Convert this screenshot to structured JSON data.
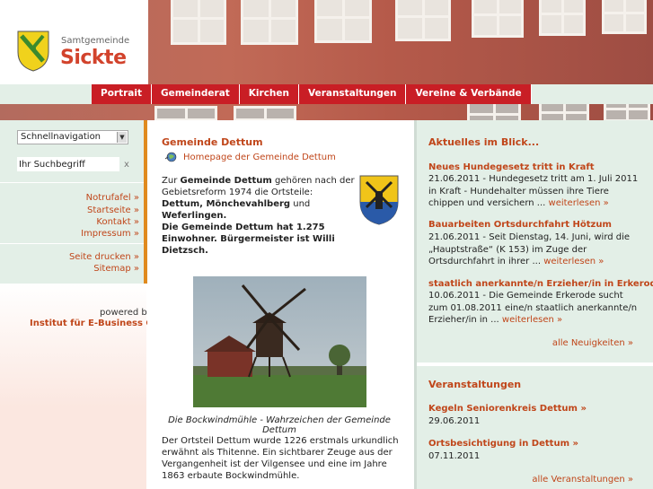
{
  "logo": {
    "small": "Samtgemeinde",
    "big": "Sickte"
  },
  "nav": [
    "Portrait",
    "Gemeinderat",
    "Kirchen",
    "Veranstaltungen",
    "Vereine & Verbände"
  ],
  "sidebar": {
    "quick_nav": "Schnellnavigation",
    "search_value": "Ihr Suchbegriff",
    "search_clear": "x",
    "links": [
      "Notrufafel",
      "Startseite",
      "Kontakt",
      "Impressum"
    ],
    "links2": [
      "Seite drucken",
      "Sitemap"
    ],
    "arrow": "»",
    "powered": "powered by",
    "powered_org": "Institut für E-Business GmbH"
  },
  "main": {
    "title": "Gemeinde Dettum",
    "homepage_link": "Homepage der Gemeinde Dettum",
    "p1_a": "Zur ",
    "p1_b": "Gemeinde Dettum",
    "p1_c": " gehören nach der Gebietsreform 1974 die Ortsteile:",
    "p1_d": "Dettum, Mönchevahlberg",
    "p1_e": " und ",
    "p1_f": "Weferlingen.",
    "p2": "Die Gemeinde Dettum hat 1.275 Einwohner. Bürgermeister ist Willi Dietzsch.",
    "caption": "Die Bockwindmühle - Wahrzeichen der Gemeinde Dettum",
    "p3": "Der Ortsteil Dettum wurde 1226 erstmals urkundlich erwähnt als Thitenne. Ein sichtbarer Zeuge aus der Vergangenheit ist der Vilgensee und eine im Jahre 1863 erbaute Bockwindmühle."
  },
  "right": {
    "news_head": "Aktuelles im Blick...",
    "news": [
      {
        "title": "Neues Hundegesetz tritt in Kraft",
        "text": "21.06.2011 - Hundegesetz tritt am 1. Juli 2011 in Kraft - Hundehalter müssen ihre Tiere chippen und versichern ... ",
        "more": "weiterlesen »"
      },
      {
        "title": "Bauarbeiten Ortsdurchfahrt Hötzum",
        "text": "21.06.2011 - Seit Dienstag, 14. Juni, wird die „Hauptstraße“ (K 153) im Zuge der Ortsdurchfahrt in ihrer ... ",
        "more": "weiterlesen »"
      },
      {
        "title": "staatlich anerkannte/n Erzieher/in in Erkerode",
        "text": "10.06.2011 - Die Gemeinde Erkerode sucht zum 01.08.2011 eine/n staatlich anerkannte/n Erzieher/in in ... ",
        "more": "weiterlesen »"
      }
    ],
    "news_all": "alle Neuigkeiten »",
    "events_head": "Veranstaltungen",
    "events": [
      {
        "title": "Kegeln Seniorenkreis Dettum »",
        "date": "29.06.2011"
      },
      {
        "title": "Ortsbesichtigung in Dettum »",
        "date": "07.11.2011"
      }
    ],
    "events_all": "alle Veranstaltungen »"
  }
}
